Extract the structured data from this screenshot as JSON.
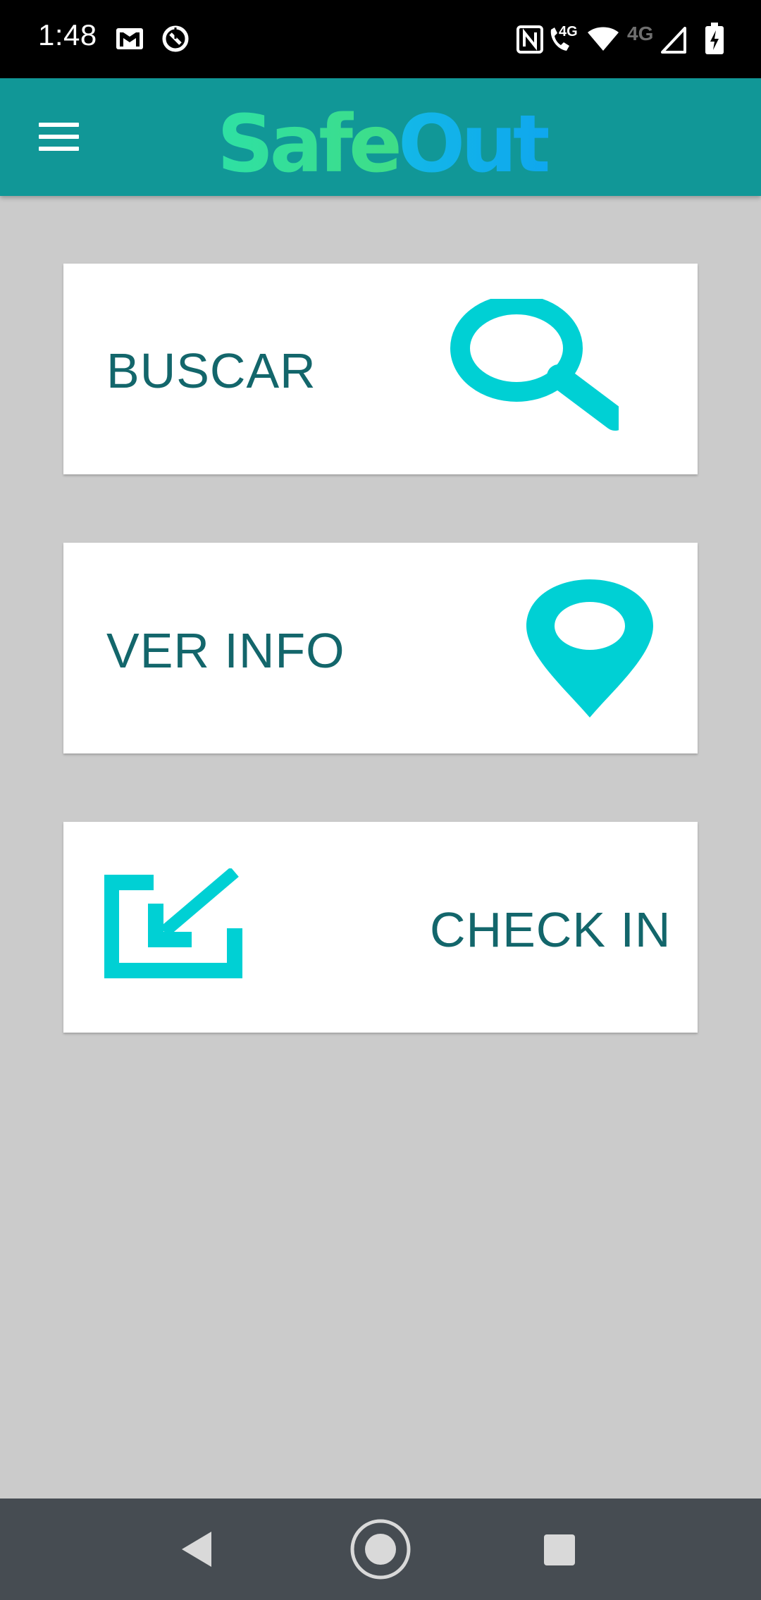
{
  "status_bar": {
    "time": "1:48",
    "network_label": "4G",
    "secondary_network_label": "4G",
    "icons": [
      "gmail-icon",
      "sync-icon",
      "nfc-icon",
      "wifi-call-icon",
      "wifi-icon",
      "cell-signal-icon",
      "battery-charging-icon"
    ]
  },
  "app_bar": {
    "title_part1": "Safe",
    "title_part2": "Out",
    "menu_icon": "hamburger-menu-icon"
  },
  "cards": [
    {
      "label": "BUSCAR",
      "icon": "search-icon"
    },
    {
      "label": "VER INFO",
      "icon": "location-pin-icon"
    },
    {
      "label": "CHECK IN",
      "icon": "check-in-arrow-icon"
    }
  ],
  "nav_bar": {
    "icons": [
      "back-icon",
      "home-icon",
      "recents-icon"
    ]
  },
  "colors": {
    "app_bar": "#119797",
    "background": "#cbcbcb",
    "card_text": "#13666b",
    "icon_accent": "#00d0d4",
    "logo_gradient_start": "#2ee0a4",
    "logo_green": "#48d66c",
    "logo_cyan": "#19cddf",
    "logo_blue": "#0fa7ee"
  }
}
